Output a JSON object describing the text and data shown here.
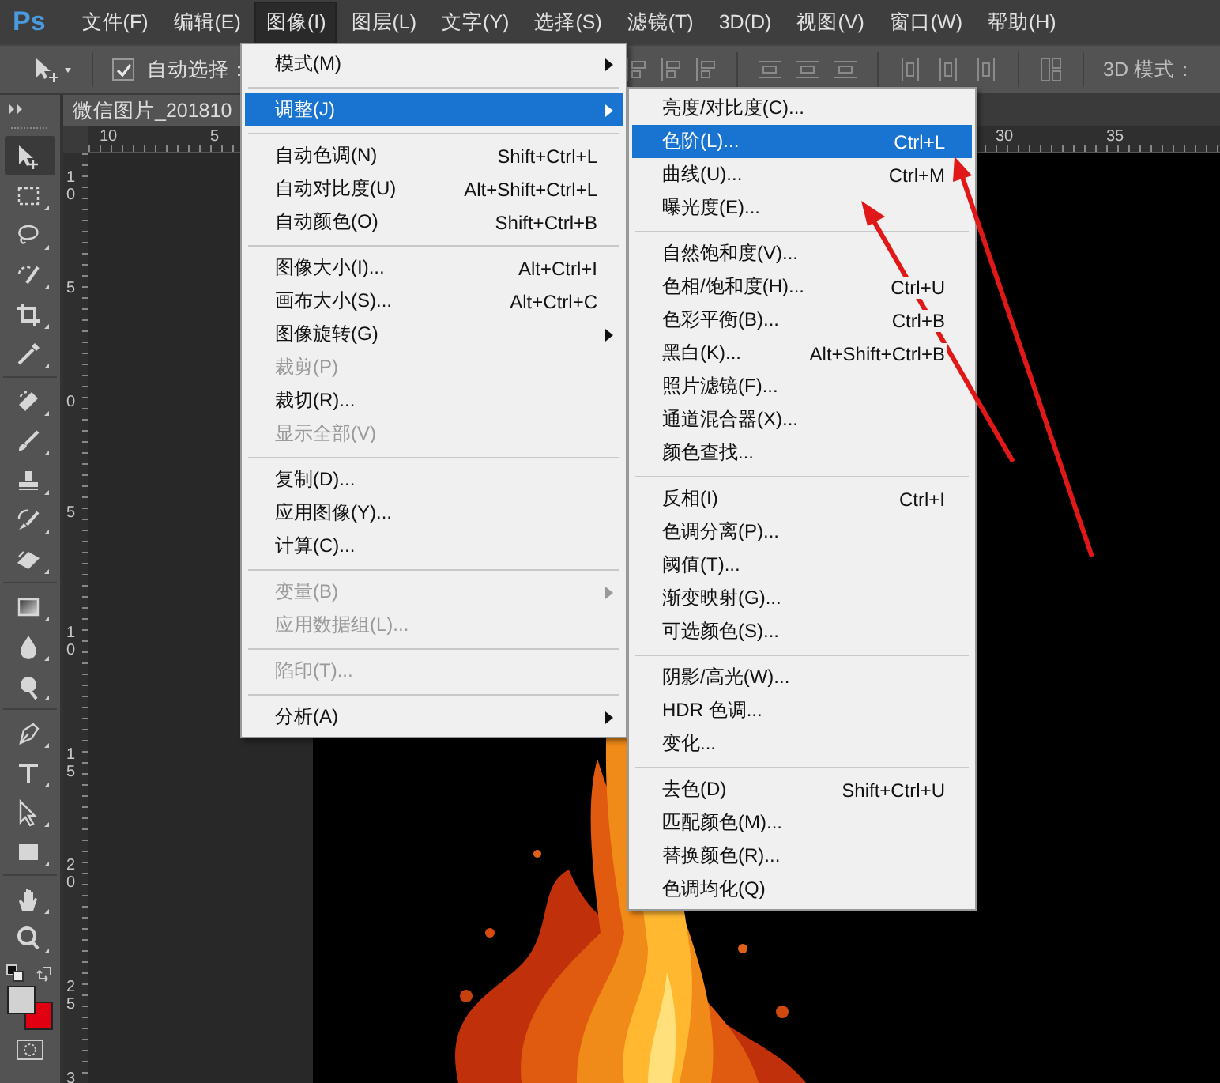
{
  "app_logo": "Ps",
  "menubar": [
    {
      "label": "文件(F)",
      "selected": false
    },
    {
      "label": "编辑(E)",
      "selected": false
    },
    {
      "label": "图像(I)",
      "selected": true
    },
    {
      "label": "图层(L)",
      "selected": false
    },
    {
      "label": "文字(Y)",
      "selected": false
    },
    {
      "label": "选择(S)",
      "selected": false
    },
    {
      "label": "滤镜(T)",
      "selected": false
    },
    {
      "label": "3D(D)",
      "selected": false
    },
    {
      "label": "视图(V)",
      "selected": false
    },
    {
      "label": "窗口(W)",
      "selected": false
    },
    {
      "label": "帮助(H)",
      "selected": false
    }
  ],
  "options_bar": {
    "auto_select": {
      "label": "自动选择：",
      "checked": true
    },
    "mode_label": "3D 模式："
  },
  "document_tab": {
    "title": "微信图片_201810"
  },
  "top_ruler": [
    "10",
    "5",
    "30",
    "35"
  ],
  "left_ruler": [
    "10",
    "5",
    "0",
    "5",
    "10",
    "15",
    "20",
    "25",
    "3"
  ],
  "image_menu": [
    {
      "kind": "item",
      "label": "模式(M)",
      "has_submenu": true,
      "disabled": false,
      "selected": false
    },
    {
      "kind": "separator"
    },
    {
      "kind": "item",
      "label": "调整(J)",
      "has_submenu": true,
      "disabled": false,
      "selected": true
    },
    {
      "kind": "separator"
    },
    {
      "kind": "item",
      "label": "自动色调(N)",
      "shortcut": "Shift+Ctrl+L",
      "has_submenu": false,
      "disabled": false,
      "selected": false
    },
    {
      "kind": "item",
      "label": "自动对比度(U)",
      "shortcut": "Alt+Shift+Ctrl+L",
      "has_submenu": false,
      "disabled": false,
      "selected": false
    },
    {
      "kind": "item",
      "label": "自动颜色(O)",
      "shortcut": "Shift+Ctrl+B",
      "has_submenu": false,
      "disabled": false,
      "selected": false
    },
    {
      "kind": "separator"
    },
    {
      "kind": "item",
      "label": "图像大小(I)...",
      "shortcut": "Alt+Ctrl+I",
      "has_submenu": false,
      "disabled": false,
      "selected": false
    },
    {
      "kind": "item",
      "label": "画布大小(S)...",
      "shortcut": "Alt+Ctrl+C",
      "has_submenu": false,
      "disabled": false,
      "selected": false
    },
    {
      "kind": "item",
      "label": "图像旋转(G)",
      "has_submenu": true,
      "disabled": false,
      "selected": false
    },
    {
      "kind": "item",
      "label": "裁剪(P)",
      "has_submenu": false,
      "disabled": true,
      "selected": false
    },
    {
      "kind": "item",
      "label": "裁切(R)...",
      "has_submenu": false,
      "disabled": false,
      "selected": false
    },
    {
      "kind": "item",
      "label": "显示全部(V)",
      "has_submenu": false,
      "disabled": true,
      "selected": false
    },
    {
      "kind": "separator"
    },
    {
      "kind": "item",
      "label": "复制(D)...",
      "has_submenu": false,
      "disabled": false,
      "selected": false
    },
    {
      "kind": "item",
      "label": "应用图像(Y)...",
      "has_submenu": false,
      "disabled": false,
      "selected": false
    },
    {
      "kind": "item",
      "label": "计算(C)...",
      "has_submenu": false,
      "disabled": false,
      "selected": false
    },
    {
      "kind": "separator"
    },
    {
      "kind": "item",
      "label": "变量(B)",
      "has_submenu": true,
      "disabled": true,
      "selected": false
    },
    {
      "kind": "item",
      "label": "应用数据组(L)...",
      "has_submenu": false,
      "disabled": true,
      "selected": false
    },
    {
      "kind": "separator"
    },
    {
      "kind": "item",
      "label": "陷印(T)...",
      "has_submenu": false,
      "disabled": true,
      "selected": false
    },
    {
      "kind": "separator"
    },
    {
      "kind": "item",
      "label": "分析(A)",
      "has_submenu": true,
      "disabled": false,
      "selected": false
    }
  ],
  "adjust_submenu": [
    {
      "kind": "item",
      "label": "亮度/对比度(C)...",
      "selected": false
    },
    {
      "kind": "item",
      "label": "色阶(L)...",
      "shortcut": "Ctrl+L",
      "selected": true
    },
    {
      "kind": "item",
      "label": "曲线(U)...",
      "shortcut": "Ctrl+M",
      "selected": false
    },
    {
      "kind": "item",
      "label": "曝光度(E)...",
      "selected": false
    },
    {
      "kind": "separator"
    },
    {
      "kind": "item",
      "label": "自然饱和度(V)...",
      "selected": false
    },
    {
      "kind": "item",
      "label": "色相/饱和度(H)...",
      "shortcut": "Ctrl+U",
      "selected": false
    },
    {
      "kind": "item",
      "label": "色彩平衡(B)...",
      "shortcut": "Ctrl+B",
      "selected": false
    },
    {
      "kind": "item",
      "label": "黑白(K)...",
      "shortcut": "Alt+Shift+Ctrl+B",
      "selected": false
    },
    {
      "kind": "item",
      "label": "照片滤镜(F)...",
      "selected": false
    },
    {
      "kind": "item",
      "label": "通道混合器(X)...",
      "selected": false
    },
    {
      "kind": "item",
      "label": "颜色查找...",
      "selected": false
    },
    {
      "kind": "separator"
    },
    {
      "kind": "item",
      "label": "反相(I)",
      "shortcut": "Ctrl+I",
      "selected": false
    },
    {
      "kind": "item",
      "label": "色调分离(P)...",
      "selected": false
    },
    {
      "kind": "item",
      "label": "阈值(T)...",
      "selected": false
    },
    {
      "kind": "item",
      "label": "渐变映射(G)...",
      "selected": false
    },
    {
      "kind": "item",
      "label": "可选颜色(S)...",
      "selected": false
    },
    {
      "kind": "separator"
    },
    {
      "kind": "item",
      "label": "阴影/高光(W)...",
      "selected": false
    },
    {
      "kind": "item",
      "label": "HDR 色调...",
      "selected": false
    },
    {
      "kind": "item",
      "label": "变化...",
      "selected": false
    },
    {
      "kind": "separator"
    },
    {
      "kind": "item",
      "label": "去色(D)",
      "shortcut": "Shift+Ctrl+U",
      "selected": false
    },
    {
      "kind": "item",
      "label": "匹配颜色(M)...",
      "selected": false
    },
    {
      "kind": "item",
      "label": "替换颜色(R)...",
      "selected": false
    },
    {
      "kind": "item",
      "label": "色调均化(Q)",
      "selected": false
    }
  ]
}
